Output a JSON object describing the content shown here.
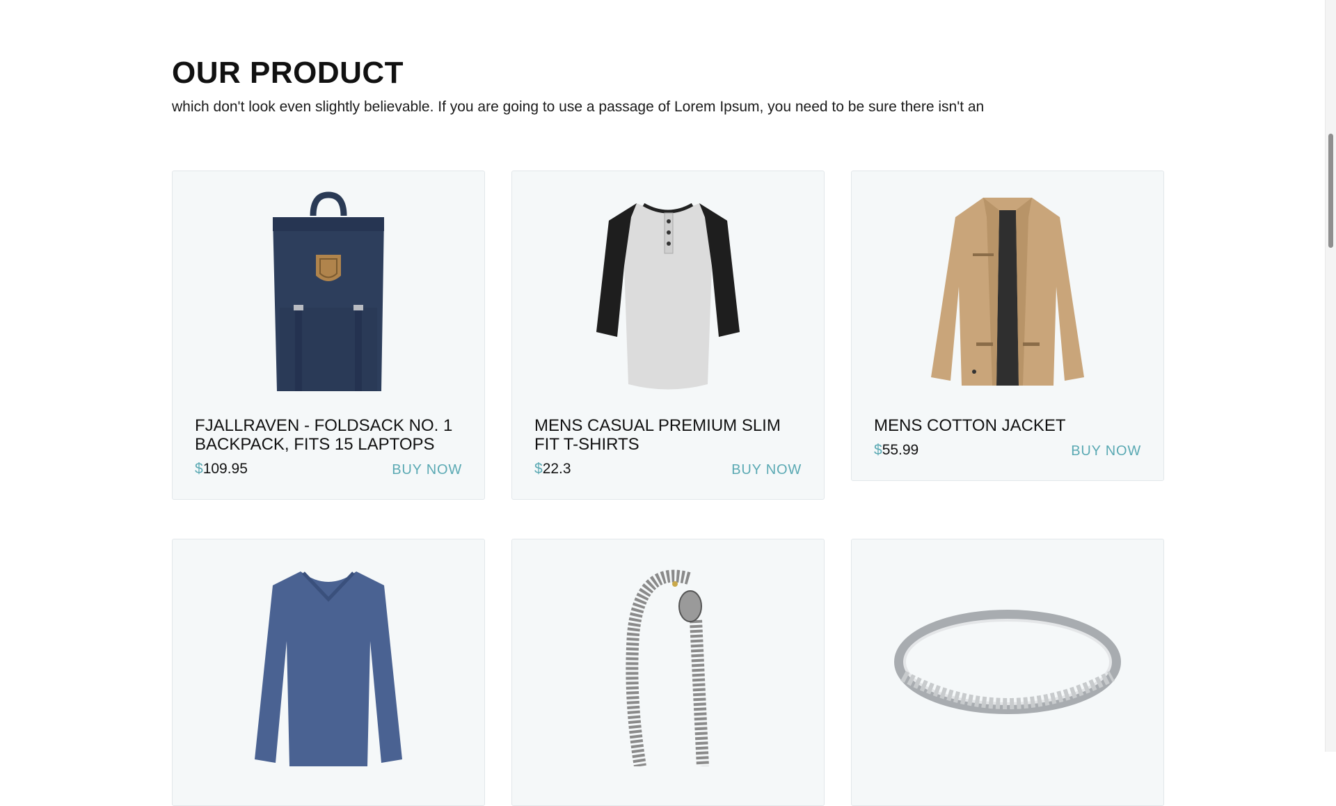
{
  "section": {
    "title": "OUR PRODUCT",
    "subtitle": "which don't look even slightly believable. If you are going to use a passage of Lorem Ipsum, you need to be sure there isn't an"
  },
  "accent_color": "#5aa9b3",
  "products": [
    {
      "name": "FJALLRAVEN - FOLDSACK NO. 1 BACKPACK, FITS 15 LAPTOPS",
      "currency": "$",
      "price": "109.95",
      "buy_label": "BUY NOW",
      "image": "backpack-image"
    },
    {
      "name": "MENS CASUAL PREMIUM SLIM FIT T-SHIRTS",
      "currency": "$",
      "price": "22.3",
      "buy_label": "BUY NOW",
      "image": "raglan-tshirt-image"
    },
    {
      "name": "MENS COTTON JACKET",
      "currency": "$",
      "price": "55.99",
      "buy_label": "BUY NOW",
      "image": "jacket-image"
    },
    {
      "name": "",
      "currency": "",
      "price": "",
      "buy_label": "",
      "image": "longsleeve-shirt-image"
    },
    {
      "name": "",
      "currency": "",
      "price": "",
      "buy_label": "",
      "image": "chain-bracelet-image"
    },
    {
      "name": "",
      "currency": "",
      "price": "",
      "buy_label": "",
      "image": "silver-ring-image"
    }
  ]
}
